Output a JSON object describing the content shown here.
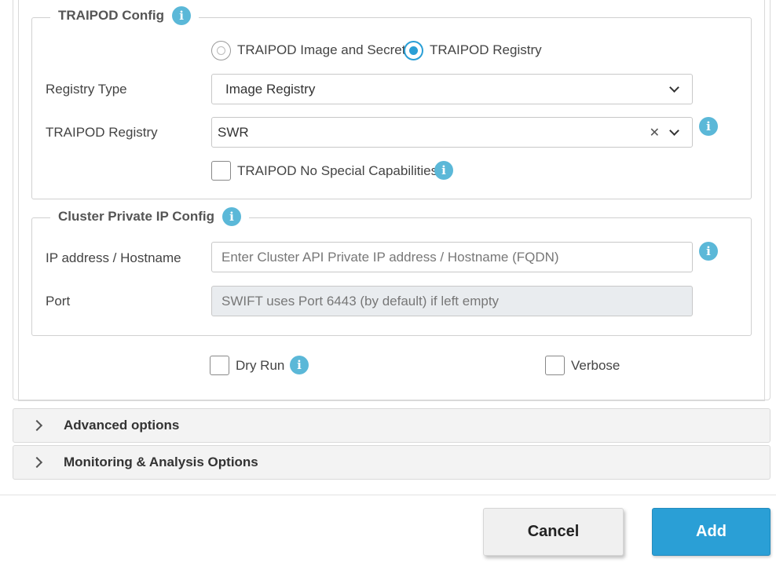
{
  "traipod_config": {
    "title": "TRAIPOD Config",
    "radio_options": [
      {
        "label": "TRAIPOD Image and Secret",
        "checked": false
      },
      {
        "label": "TRAIPOD Registry",
        "checked": true
      }
    ],
    "registry_type_label": "Registry Type",
    "registry_type_value": "Image Registry",
    "registry_label": "TRAIPOD Registry",
    "registry_value": "SWR",
    "no_special_caps_label": "TRAIPOD No Special Capabilities"
  },
  "cluster_private_ip": {
    "title": "Cluster Private IP Config",
    "ip_label": "IP address / Hostname",
    "ip_placeholder": "Enter Cluster API Private IP address / Hostname (FQDN)",
    "port_label": "Port",
    "port_placeholder": "SWIFT uses Port 6443 (by default) if left empty"
  },
  "options": {
    "dry_run_label": "Dry Run",
    "verbose_label": "Verbose"
  },
  "accordions": [
    {
      "title": "Advanced options"
    },
    {
      "title": "Monitoring & Analysis Options"
    }
  ],
  "footer": {
    "cancel_label": "Cancel",
    "add_label": "Add"
  },
  "colors": {
    "accent": "#2a9fd6",
    "info_icon": "#5bb8d8"
  },
  "icons": {
    "info": "info-icon",
    "clear": "close-icon",
    "dropdown": "chevron-down-icon",
    "expand": "chevron-right-icon"
  }
}
